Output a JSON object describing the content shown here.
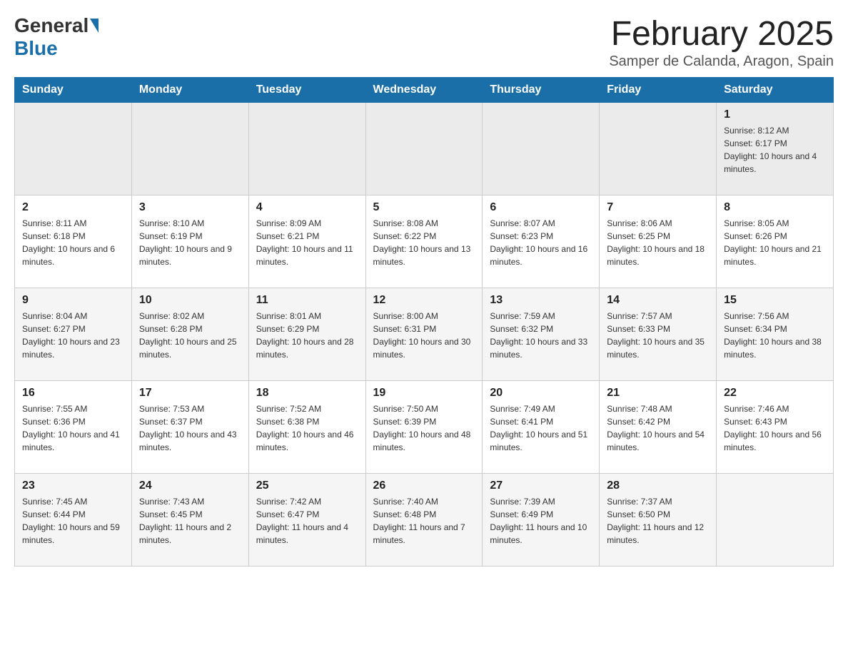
{
  "header": {
    "logo_general": "General",
    "logo_blue": "Blue",
    "month_title": "February 2025",
    "location": "Samper de Calanda, Aragon, Spain"
  },
  "weekdays": [
    "Sunday",
    "Monday",
    "Tuesday",
    "Wednesday",
    "Thursday",
    "Friday",
    "Saturday"
  ],
  "weeks": [
    [
      {
        "day": "",
        "info": ""
      },
      {
        "day": "",
        "info": ""
      },
      {
        "day": "",
        "info": ""
      },
      {
        "day": "",
        "info": ""
      },
      {
        "day": "",
        "info": ""
      },
      {
        "day": "",
        "info": ""
      },
      {
        "day": "1",
        "info": "Sunrise: 8:12 AM\nSunset: 6:17 PM\nDaylight: 10 hours and 4 minutes."
      }
    ],
    [
      {
        "day": "2",
        "info": "Sunrise: 8:11 AM\nSunset: 6:18 PM\nDaylight: 10 hours and 6 minutes."
      },
      {
        "day": "3",
        "info": "Sunrise: 8:10 AM\nSunset: 6:19 PM\nDaylight: 10 hours and 9 minutes."
      },
      {
        "day": "4",
        "info": "Sunrise: 8:09 AM\nSunset: 6:21 PM\nDaylight: 10 hours and 11 minutes."
      },
      {
        "day": "5",
        "info": "Sunrise: 8:08 AM\nSunset: 6:22 PM\nDaylight: 10 hours and 13 minutes."
      },
      {
        "day": "6",
        "info": "Sunrise: 8:07 AM\nSunset: 6:23 PM\nDaylight: 10 hours and 16 minutes."
      },
      {
        "day": "7",
        "info": "Sunrise: 8:06 AM\nSunset: 6:25 PM\nDaylight: 10 hours and 18 minutes."
      },
      {
        "day": "8",
        "info": "Sunrise: 8:05 AM\nSunset: 6:26 PM\nDaylight: 10 hours and 21 minutes."
      }
    ],
    [
      {
        "day": "9",
        "info": "Sunrise: 8:04 AM\nSunset: 6:27 PM\nDaylight: 10 hours and 23 minutes."
      },
      {
        "day": "10",
        "info": "Sunrise: 8:02 AM\nSunset: 6:28 PM\nDaylight: 10 hours and 25 minutes."
      },
      {
        "day": "11",
        "info": "Sunrise: 8:01 AM\nSunset: 6:29 PM\nDaylight: 10 hours and 28 minutes."
      },
      {
        "day": "12",
        "info": "Sunrise: 8:00 AM\nSunset: 6:31 PM\nDaylight: 10 hours and 30 minutes."
      },
      {
        "day": "13",
        "info": "Sunrise: 7:59 AM\nSunset: 6:32 PM\nDaylight: 10 hours and 33 minutes."
      },
      {
        "day": "14",
        "info": "Sunrise: 7:57 AM\nSunset: 6:33 PM\nDaylight: 10 hours and 35 minutes."
      },
      {
        "day": "15",
        "info": "Sunrise: 7:56 AM\nSunset: 6:34 PM\nDaylight: 10 hours and 38 minutes."
      }
    ],
    [
      {
        "day": "16",
        "info": "Sunrise: 7:55 AM\nSunset: 6:36 PM\nDaylight: 10 hours and 41 minutes."
      },
      {
        "day": "17",
        "info": "Sunrise: 7:53 AM\nSunset: 6:37 PM\nDaylight: 10 hours and 43 minutes."
      },
      {
        "day": "18",
        "info": "Sunrise: 7:52 AM\nSunset: 6:38 PM\nDaylight: 10 hours and 46 minutes."
      },
      {
        "day": "19",
        "info": "Sunrise: 7:50 AM\nSunset: 6:39 PM\nDaylight: 10 hours and 48 minutes."
      },
      {
        "day": "20",
        "info": "Sunrise: 7:49 AM\nSunset: 6:41 PM\nDaylight: 10 hours and 51 minutes."
      },
      {
        "day": "21",
        "info": "Sunrise: 7:48 AM\nSunset: 6:42 PM\nDaylight: 10 hours and 54 minutes."
      },
      {
        "day": "22",
        "info": "Sunrise: 7:46 AM\nSunset: 6:43 PM\nDaylight: 10 hours and 56 minutes."
      }
    ],
    [
      {
        "day": "23",
        "info": "Sunrise: 7:45 AM\nSunset: 6:44 PM\nDaylight: 10 hours and 59 minutes."
      },
      {
        "day": "24",
        "info": "Sunrise: 7:43 AM\nSunset: 6:45 PM\nDaylight: 11 hours and 2 minutes."
      },
      {
        "day": "25",
        "info": "Sunrise: 7:42 AM\nSunset: 6:47 PM\nDaylight: 11 hours and 4 minutes."
      },
      {
        "day": "26",
        "info": "Sunrise: 7:40 AM\nSunset: 6:48 PM\nDaylight: 11 hours and 7 minutes."
      },
      {
        "day": "27",
        "info": "Sunrise: 7:39 AM\nSunset: 6:49 PM\nDaylight: 11 hours and 10 minutes."
      },
      {
        "day": "28",
        "info": "Sunrise: 7:37 AM\nSunset: 6:50 PM\nDaylight: 11 hours and 12 minutes."
      },
      {
        "day": "",
        "info": ""
      }
    ]
  ]
}
